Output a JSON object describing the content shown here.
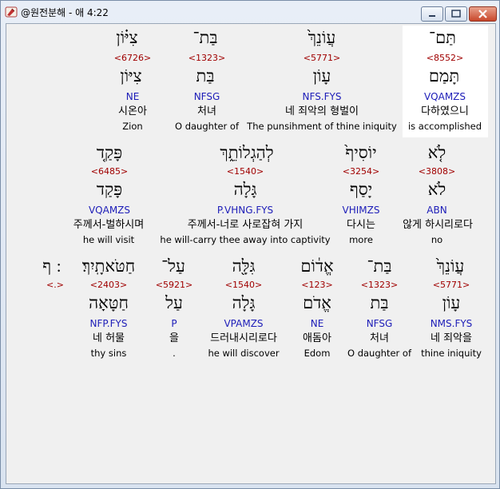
{
  "window": {
    "title": "@원전분해 - 애 4:22",
    "close_glyph": "✕"
  },
  "rows": [
    {
      "words": [
        {
          "surface": "צִיּ֗וֹן",
          "strong": "<6726>",
          "lemma": "צִיּוֹן",
          "code": "NE",
          "ko": "시온아",
          "en": "Zion"
        },
        {
          "surface": "בַּת־",
          "strong": "<1323>",
          "lemma": "בַּת",
          "code": "NFSG",
          "ko": "처녀",
          "en": "O daughter of"
        },
        {
          "surface": "עֲוֹנֵךְ֙",
          "strong": "<5771>",
          "lemma": "עָוֹן",
          "code": "NFS.FYS",
          "ko": "네 죄악의 형벌이",
          "en": "The punsihment of thine iniquity"
        },
        {
          "surface": "תַּם־",
          "strong": "<8552>",
          "lemma": "תָּמַם",
          "code": "VQAMZS",
          "ko": "다하였으니",
          "en": "is accomplished"
        }
      ]
    },
    {
      "words": [
        {
          "surface": "פָּקַ֤ד",
          "strong": "<6485>",
          "lemma": "פָּקַד",
          "code": "VQAMZS",
          "ko": "주께서-벌하시며",
          "en": "he will  visit"
        },
        {
          "surface": "לְהַגְלוֹתֵ֑ךְ",
          "strong": "<1540>",
          "lemma": "גָּלָה",
          "code": "P.VHNG.FYS",
          "ko": "주께서-너로 사로잡혀 가지",
          "en": "he will-carry thee away into captivity"
        },
        {
          "surface": "יוֹסִיף֙",
          "strong": "<3254>",
          "lemma": "יָסַף",
          "code": "VHIMZS",
          "ko": "다시는",
          "en": "more"
        },
        {
          "surface": "לֹ֤א",
          "strong": "<3808>",
          "lemma": "לֹא",
          "code": "ABN",
          "ko": "않게 하시리로다",
          "en": "no"
        }
      ]
    },
    {
      "words": [
        {
          "surface": "׃ ף",
          "strong": "<.>",
          "lemma": "",
          "code": "",
          "ko": "",
          "en": ""
        },
        {
          "surface": "חַטֹּאתָֽיִךְ׃",
          "strong": "<2403>",
          "lemma": "חַטָּאָה",
          "code": "NFP.FYS",
          "ko": "네 허물",
          "en": "thy sins"
        },
        {
          "surface": "עַל־",
          "strong": "<5921>",
          "lemma": "עַל",
          "code": "P",
          "ko": "을",
          "en": "."
        },
        {
          "surface": "גִּלָּ֖ה",
          "strong": "<1540>",
          "lemma": "גָּלָה",
          "code": "VPAMZS",
          "ko": "드러내시리로다",
          "en": "he will discover"
        },
        {
          "surface": "אֱד֔וֹם",
          "strong": "<123>",
          "lemma": "אֱדֹם",
          "code": "NE",
          "ko": "애돔아",
          "en": "Edom"
        },
        {
          "surface": "בַּת־",
          "strong": "<1323>",
          "lemma": "בַּת",
          "code": "NFSG",
          "ko": "처녀",
          "en": "O daughter of"
        },
        {
          "surface": "עֲוֹנֵךְ֙",
          "strong": "<5771>",
          "lemma": "עָוֹן",
          "code": "NMS.FYS",
          "ko": "네 죄악을",
          "en": "thine iniquity"
        }
      ]
    }
  ],
  "colors": {
    "strong": "#a00000",
    "code": "#1d1db8",
    "highlight": "#ffffff"
  },
  "icons": {
    "app": "bible-app-icon",
    "minimize": "minimize-icon",
    "maximize": "maximize-icon",
    "close": "close-icon"
  }
}
